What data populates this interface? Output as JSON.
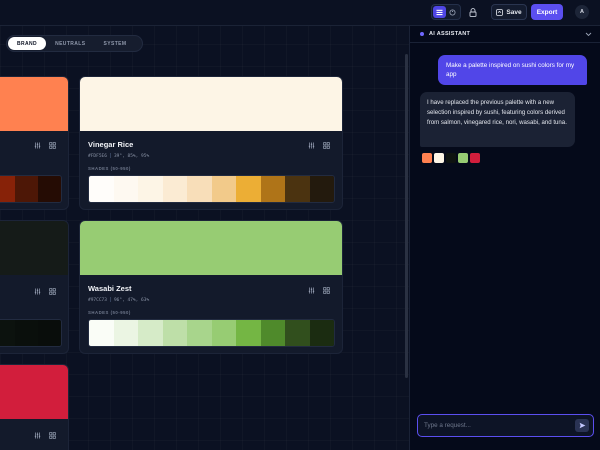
{
  "topbar": {
    "view_toggle": [
      "grid-view",
      "shuffle-view"
    ],
    "save_label": "Save",
    "export_label": "Export",
    "avatar_initial": "A"
  },
  "tabs": [
    {
      "label": "BRAND",
      "active": true
    },
    {
      "label": "NEUTRALS",
      "active": false
    },
    {
      "label": "SYSTEM",
      "active": false
    }
  ],
  "shades_label": "SHADES (50-950)",
  "cards": [
    {
      "name": "Vinegar Rice",
      "hex": "#FDF5E6",
      "hsl": "39°, 85%, 95%",
      "color": "#FDF5E6",
      "shades": [
        "#FFFDFA",
        "#FEF9F1",
        "#FDF5E6",
        "#FBEBD3",
        "#F8DEB9",
        "#F2CA8A",
        "#ECAE35",
        "#AF7418",
        "#4B3310",
        "#231A0D"
      ]
    },
    {
      "name": "Wasabi Zest",
      "hex": "#97CC73",
      "hsl": "96°, 47%, 63%",
      "color": "#97CC73",
      "shades": [
        "#FAFDF7",
        "#EBF5E3",
        "#D6EBC8",
        "#BEDFA8",
        "#A8D58C",
        "#97CC73",
        "#74B644",
        "#4F8A2B",
        "#314F1D",
        "#1B2C11"
      ]
    }
  ],
  "partial_cards": [
    {
      "color": "#FF8150",
      "shades": [
        "#872208",
        "#4D1706",
        "#250C04"
      ]
    },
    {
      "color": "#151B18",
      "shades": [
        "#0C120E",
        "#0A0F0C",
        "#090D0B"
      ]
    },
    {
      "color": "#D21E3C"
    }
  ],
  "assistant": {
    "title": "AI ASSISTANT",
    "user_message": "Make a palette inspired on sushi colors for my app",
    "bot_message": "I have replaced the previous palette with a new selection inspired by sushi, featuring colors derived from salmon, vinegared rice, nori, wasabi, and tuna.",
    "mini_swatches": [
      "#FF8150",
      "#FDF5E6",
      "#0E1310",
      "#97CC73",
      "#D21E3C"
    ],
    "input_placeholder": "Type a request..."
  },
  "colors": {
    "accent": "#5B4FF0",
    "background": "#0B1122",
    "panel": "#050A1A"
  }
}
